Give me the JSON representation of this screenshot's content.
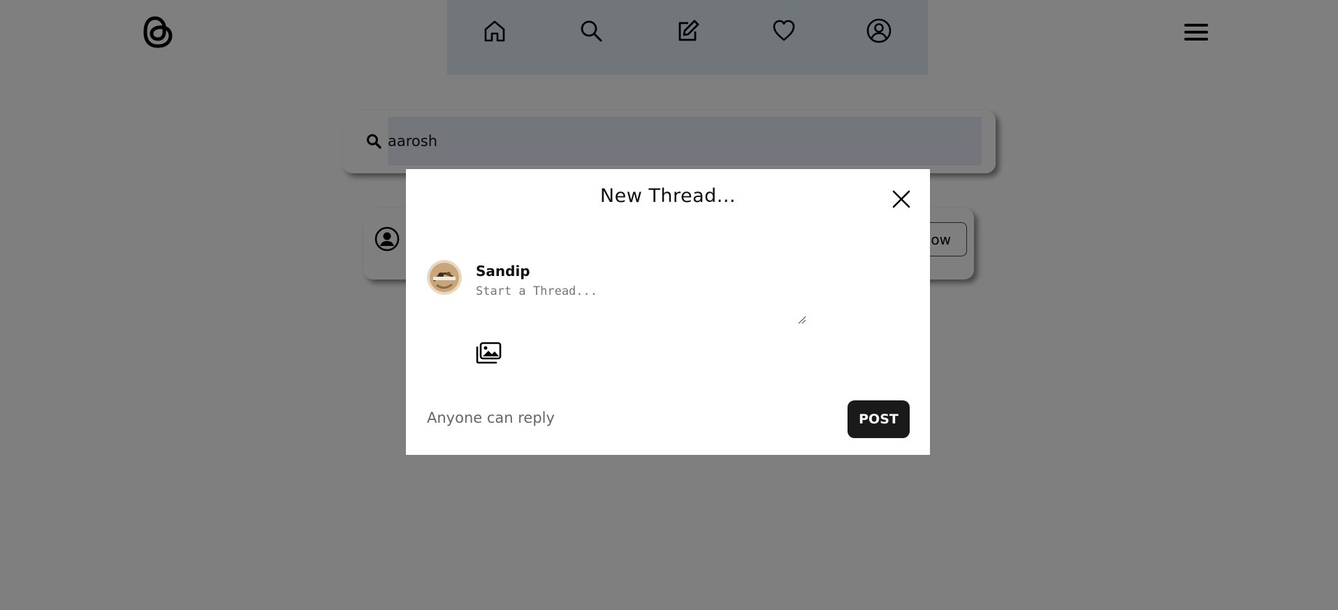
{
  "header": {
    "logo_icon": "threads-logo-icon",
    "nav": [
      {
        "name": "home",
        "icon": "home-icon"
      },
      {
        "name": "search",
        "icon": "search-icon"
      },
      {
        "name": "create",
        "icon": "edit-icon"
      },
      {
        "name": "activity",
        "icon": "heart-icon"
      },
      {
        "name": "profile",
        "icon": "user-circle-icon"
      }
    ],
    "menu_icon": "hamburger-menu-icon"
  },
  "search": {
    "value": "aarosh",
    "icon": "search-icon"
  },
  "result": {
    "avatar_icon": "user-circle-icon",
    "follow_label": "Follow"
  },
  "modal": {
    "title": "New Thread...",
    "close_icon": "close-icon",
    "user_name": "Sandip",
    "input_placeholder": "Start a Thread...",
    "media_icon": "images-icon",
    "reply_text": "Anyone can reply",
    "post_label": "POST"
  },
  "colors": {
    "nav_background": "#e3ecf7",
    "search_field": "#e6edf6",
    "overlay": "rgba(0,0,0,0.5)",
    "post_button": "#1a1a1a"
  }
}
